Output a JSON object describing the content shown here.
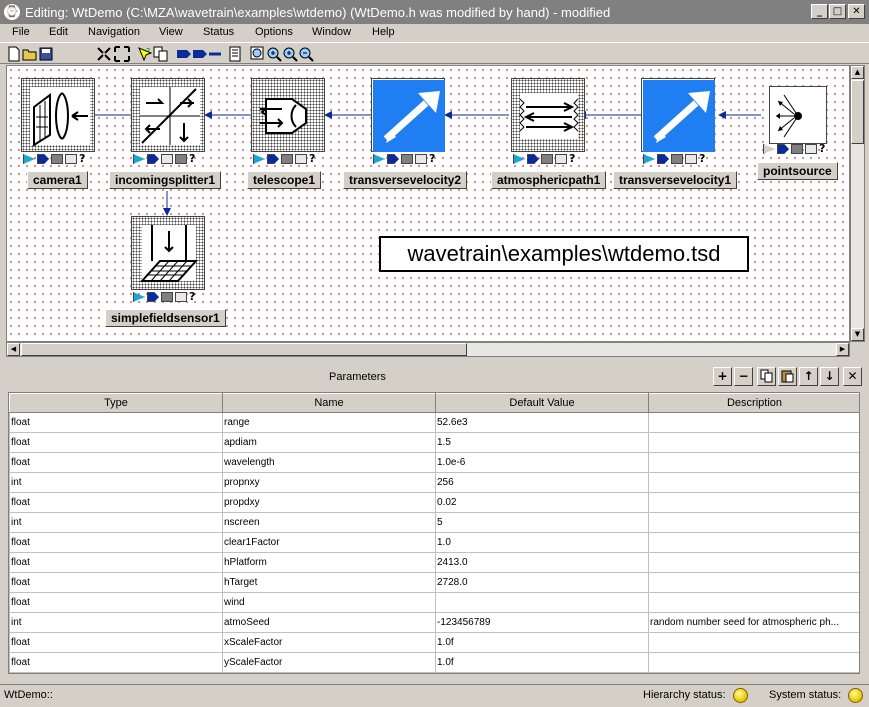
{
  "window": {
    "icon": "clock-icon",
    "title": "Editing:  WtDemo  (C:\\MZA\\wavetrain\\examples\\wtdemo)   (WtDemo.h was modified by hand) - modified",
    "controls": {
      "minimize": "_",
      "maximize": "□",
      "close": "✕"
    }
  },
  "menu": [
    "File",
    "Edit",
    "Navigation",
    "View",
    "Status",
    "Options",
    "Window",
    "Help"
  ],
  "toolbar": [
    "new-icon",
    "open-icon",
    "save-icon",
    "collapse-icon",
    "expand-icon",
    "help-cursor-icon",
    "hierarchy-icon",
    "connect-icon",
    "run-icon",
    "properties-icon",
    "zoom-fit-icon",
    "zoom-in-icon",
    "zoom-out-icon"
  ],
  "blocks": [
    {
      "name": "camera1",
      "icon": "camera-icon"
    },
    {
      "name": "incomingsplitter1",
      "icon": "splitter-icon"
    },
    {
      "name": "telescope1",
      "icon": "telescope-icon"
    },
    {
      "name": "transversevelocity2",
      "icon": "velocity-arrow-icon"
    },
    {
      "name": "atmosphericpath1",
      "icon": "atmosphere-icon"
    },
    {
      "name": "transversevelocity1",
      "icon": "velocity-arrow-icon"
    },
    {
      "name": "pointsource",
      "icon": "point-source-icon"
    },
    {
      "name": "simplefieldsensor1",
      "icon": "field-sensor-icon"
    }
  ],
  "diagram_label": "wavetrain\\examples\\wtdemo.tsd",
  "parameters": {
    "title": "Parameters",
    "buttons": [
      "+",
      "−",
      "copy-icon",
      "paste-icon",
      "↑",
      "↓",
      "✕"
    ],
    "columns": [
      "Type",
      "Name",
      "Default Value",
      "Description"
    ],
    "rows": [
      [
        "float",
        "range",
        "52.6e3",
        ""
      ],
      [
        "float",
        "apdiam",
        "1.5",
        ""
      ],
      [
        "float",
        "wavelength",
        "1.0e-6",
        ""
      ],
      [
        "int",
        "propnxy",
        "256",
        ""
      ],
      [
        "float",
        "propdxy",
        "0.02",
        ""
      ],
      [
        "int",
        "nscreen",
        "5",
        ""
      ],
      [
        "float",
        "clear1Factor",
        "1.0",
        ""
      ],
      [
        "float",
        "hPlatform",
        "2413.0",
        ""
      ],
      [
        "float",
        "hTarget",
        "2728.0",
        ""
      ],
      [
        "float",
        "wind",
        "",
        ""
      ],
      [
        "int",
        "atmoSeed",
        "-123456789",
        "random number seed for atmospheric ph..."
      ],
      [
        "float",
        "xScaleFactor",
        "1.0f",
        ""
      ],
      [
        "float",
        "yScaleFactor",
        "1.0f",
        ""
      ]
    ]
  },
  "status": {
    "left": "WtDemo::",
    "hierarchy": "Hierarchy status:",
    "system": "System status:"
  }
}
